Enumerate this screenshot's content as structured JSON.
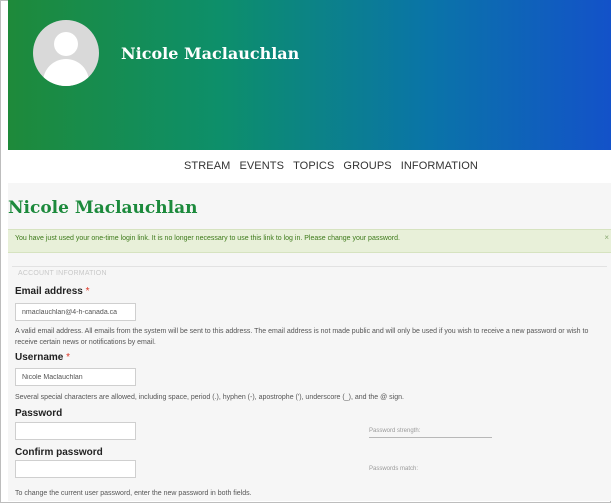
{
  "profile": {
    "name": "Nicole Maclauchlan"
  },
  "nav": {
    "items": [
      "STREAM",
      "EVENTS",
      "TOPICS",
      "GROUPS",
      "INFORMATION"
    ]
  },
  "page": {
    "title": "Nicole Maclauchlan"
  },
  "message": {
    "text": "You have just used your one-time login link. It is no longer necessary to use this link to log in. Please change your password.",
    "close": "×"
  },
  "form": {
    "section_title": "ACCOUNT INFORMATION",
    "required_mark": "*",
    "email": {
      "label": "Email address",
      "value": "nmaclauchlan@4-h-canada.ca",
      "description": "A valid email address. All emails from the system will be sent to this address. The email address is not made public and will only be used if you wish to receive a new password or wish to receive certain news or notifications by email."
    },
    "username": {
      "label": "Username",
      "value": "Nicole Maclauchlan",
      "description": "Several special characters are allowed, including space, period (.), hyphen (-), apostrophe ('), underscore (_), and the @ sign."
    },
    "password": {
      "label": "Password",
      "value": "",
      "strength_label": "Password strength:"
    },
    "confirm_password": {
      "label": "Confirm password",
      "value": "",
      "match_label": "Passwords match:"
    },
    "password_help": "To change the current user password, enter the new password in both fields."
  },
  "colors": {
    "accent_green": "#1c8a3c",
    "required": "#dd3322",
    "alert_bg": "#e8f0d9"
  }
}
